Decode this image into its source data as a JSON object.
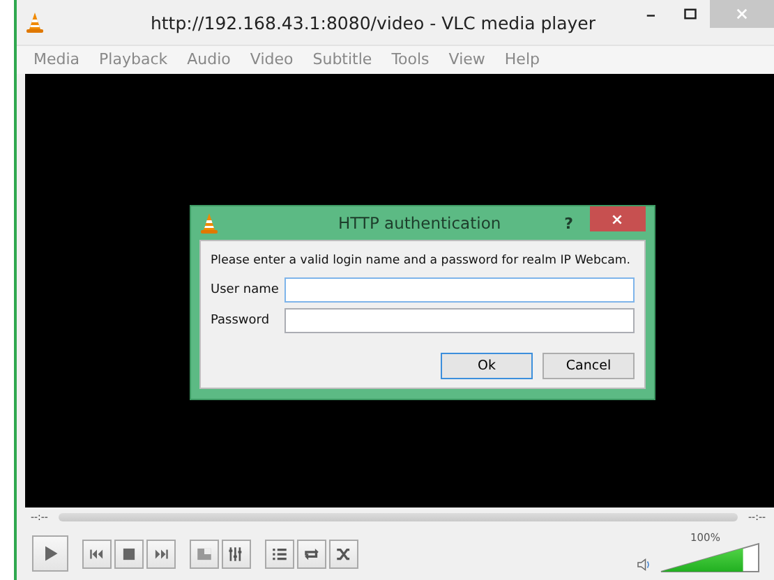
{
  "window": {
    "title": "http://192.168.43.1:8080/video - VLC media player"
  },
  "menu": [
    "Media",
    "Playback",
    "Audio",
    "Video",
    "Subtitle",
    "Tools",
    "View",
    "Help"
  ],
  "dialog": {
    "title": "HTTP authentication",
    "help": "?",
    "message": "Please enter a valid login name and a password for realm IP Webcam.",
    "fields": [
      {
        "label": "User name",
        "focused": true
      },
      {
        "label": "Password",
        "focused": false
      }
    ],
    "buttons": [
      {
        "label": "Ok",
        "default": true
      },
      {
        "label": "Cancel",
        "default": false
      }
    ]
  },
  "seek": {
    "elapsed": "--:--",
    "remaining": "--:--"
  },
  "volume": {
    "reading": "100%",
    "level": 0.84
  }
}
